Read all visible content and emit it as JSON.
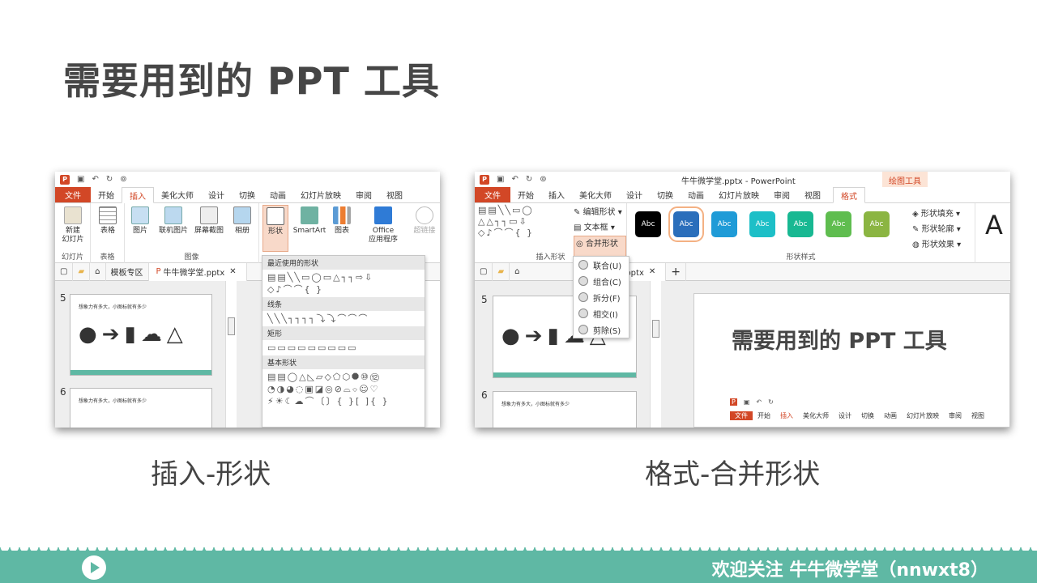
{
  "title": "需要用到的 PPT 工具",
  "captions": {
    "left": "插入-形状",
    "right": "格式-合并形状"
  },
  "footer": {
    "text": "欢迎关注 牛牛微学堂（nnwxt8）"
  },
  "left": {
    "tabs": [
      "文件",
      "开始",
      "插入",
      "美化大师",
      "设计",
      "切换",
      "动画",
      "幻灯片放映",
      "审阅",
      "视图"
    ],
    "buttons": {
      "new_slide": "新建\n幻灯片",
      "table": "表格",
      "picture": "图片",
      "online_picture": "联机图片",
      "screenshot": "屏幕截图",
      "album": "相册",
      "shapes": "形状",
      "smartart": "SmartArt",
      "chart": "图表",
      "office_apps": "Office\n应用程序",
      "hyperlink": "超链接"
    },
    "groups": {
      "slides": "幻灯片",
      "tables": "表格",
      "images": "图像"
    },
    "doc_tabs": {
      "template": "模板专区",
      "file": "牛牛微学堂.pptx"
    },
    "slide_nums": [
      "5",
      "6"
    ],
    "thumb_text": "想象力有多大，小图标就有多少",
    "dropdown": {
      "recent": "最近使用的形状",
      "lines": "线条",
      "rect": "矩形",
      "basic": "基本形状"
    }
  },
  "right": {
    "window_title": "牛牛微学堂.pptx - PowerPoint",
    "context_tab": "绘图工具",
    "tabs": [
      "文件",
      "开始",
      "插入",
      "美化大师",
      "设计",
      "切换",
      "动画",
      "幻灯片放映",
      "审阅",
      "视图",
      "格式"
    ],
    "insert_shapes": {
      "edit_shape": "编辑形状",
      "textbox": "文本框",
      "merge": "合并形状",
      "group_label": "插入形状"
    },
    "styles_label": "形状样式",
    "swatch_text": "Abc",
    "swatch_colors": [
      "#000000",
      "#2a6ebb",
      "#1f9bd7",
      "#1dbfc7",
      "#18b892",
      "#5fbd4f",
      "#8bb542"
    ],
    "fill": {
      "fill": "形状填充",
      "outline": "形状轮廓",
      "effect": "形状效果"
    },
    "merge_menu": [
      "联合(U)",
      "组合(C)",
      "拆分(F)",
      "相交(I)",
      "剪除(S)"
    ],
    "doc_tab": "堂.pptx",
    "slide_nums": [
      "5",
      "6"
    ],
    "thumb_text": "想象力有多大，小图标就有多少",
    "slide_title": "需要用到的 PPT 工具",
    "mini_tabs": [
      "文件",
      "开始",
      "插入",
      "美化大师",
      "设计",
      "切换",
      "动画",
      "幻灯片放映",
      "审阅",
      "视图"
    ]
  }
}
